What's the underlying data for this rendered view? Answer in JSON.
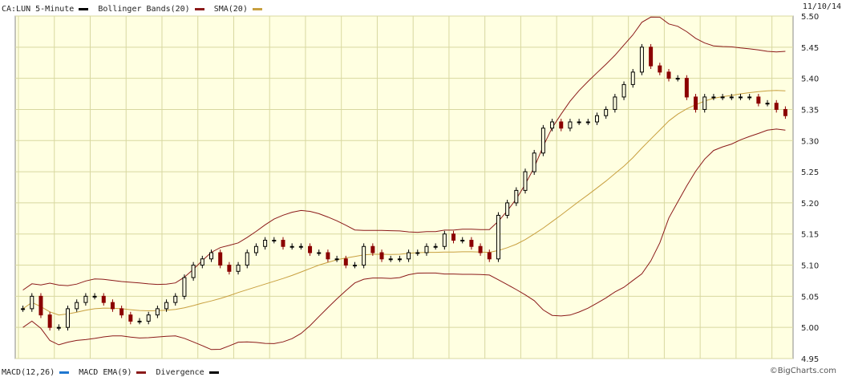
{
  "header": {
    "symbol_label": "CA:LUN 5-Minute",
    "bollinger_label": "Bollinger Bands(20)",
    "sma_label": "SMA(20)",
    "date": "11/10/14"
  },
  "footer": {
    "macd_label": "MACD(12,26)",
    "macd_ema_label": "MACD EMA(9)",
    "divergence_label": "Divergence",
    "credit": "©BigCharts.com"
  },
  "colors": {
    "background": "#ffffe1",
    "grid": "#d8d8a0",
    "up": "#000000",
    "down": "#8b0000",
    "bollinger": "#8b1a1a",
    "sma": "#c8a040",
    "macd": "#1f77d0",
    "macd_ema": "#8b1a1a",
    "divergence": "#000000"
  },
  "chart_data": {
    "type": "candlestick",
    "title": "CA:LUN 5-Minute",
    "ylim": [
      4.95,
      5.5
    ],
    "yticks": [
      "5.50",
      "5.45",
      "5.40",
      "5.35",
      "5.30",
      "5.25",
      "5.20",
      "5.15",
      "5.10",
      "5.05",
      "5.00",
      "4.95"
    ],
    "grid": true,
    "series_close_approx": [
      5.03,
      5.05,
      5.02,
      5.0,
      5.0,
      5.03,
      5.04,
      5.05,
      5.05,
      5.04,
      5.03,
      5.02,
      5.01,
      5.01,
      5.02,
      5.03,
      5.04,
      5.05,
      5.08,
      5.1,
      5.11,
      5.12,
      5.1,
      5.09,
      5.1,
      5.12,
      5.13,
      5.14,
      5.14,
      5.13,
      5.13,
      5.13,
      5.12,
      5.12,
      5.11,
      5.11,
      5.1,
      5.1,
      5.13,
      5.12,
      5.11,
      5.11,
      5.11,
      5.12,
      5.12,
      5.13,
      5.13,
      5.15,
      5.14,
      5.14,
      5.13,
      5.12,
      5.11,
      5.18,
      5.2,
      5.22,
      5.25,
      5.28,
      5.32,
      5.33,
      5.32,
      5.33,
      5.33,
      5.33,
      5.34,
      5.35,
      5.37,
      5.39,
      5.41,
      5.45,
      5.42,
      5.41,
      5.4,
      5.4,
      5.37,
      5.35,
      5.37,
      5.37,
      5.37,
      5.37,
      5.37,
      5.37,
      5.36,
      5.36,
      5.35,
      5.34
    ]
  }
}
